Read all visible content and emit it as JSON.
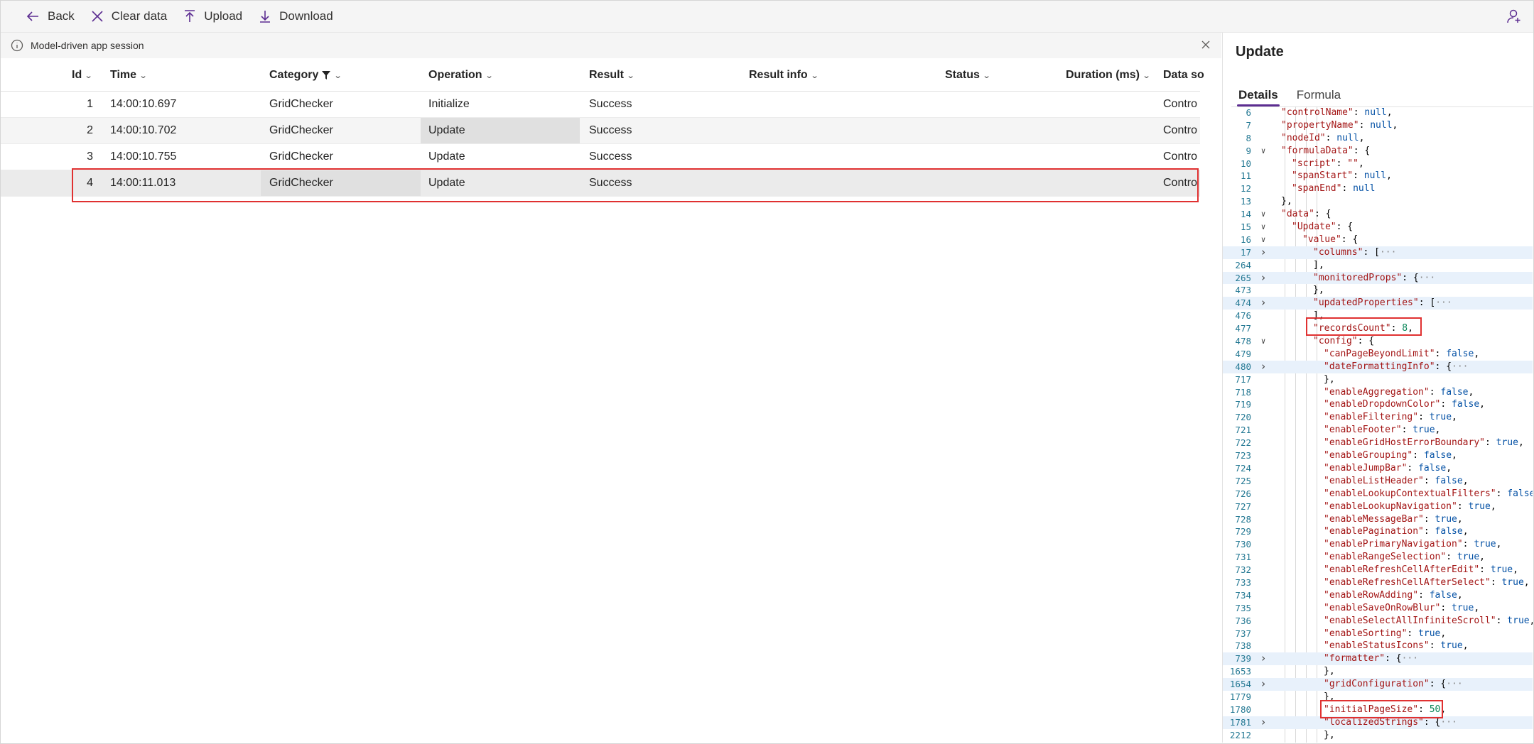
{
  "toolbar": {
    "back": "Back",
    "clear": "Clear data",
    "upload": "Upload",
    "download": "Download"
  },
  "session": {
    "label": "Model-driven app session"
  },
  "table": {
    "headers": {
      "id": "Id",
      "time": "Time",
      "category": "Category",
      "operation": "Operation",
      "result": "Result",
      "result_info": "Result info",
      "status": "Status",
      "duration": "Duration (ms)",
      "data_source": "Data so"
    },
    "rows": [
      {
        "id": "1",
        "time": "14:00:10.697",
        "category": "GridChecker",
        "operation": "Initialize",
        "result": "Success",
        "source": "Contro"
      },
      {
        "id": "2",
        "time": "14:00:10.702",
        "category": "GridChecker",
        "operation": "Update",
        "result": "Success",
        "source": "Contro"
      },
      {
        "id": "3",
        "time": "14:00:10.755",
        "category": "GridChecker",
        "operation": "Update",
        "result": "Success",
        "source": "Contro"
      },
      {
        "id": "4",
        "time": "14:00:11.013",
        "category": "GridChecker",
        "operation": "Update",
        "result": "Success",
        "source": "Contro"
      }
    ]
  },
  "panel": {
    "title": "Update",
    "tabs": [
      "Details",
      "Formula"
    ]
  },
  "editor": {
    "lines": [
      {
        "n": "6",
        "d": 0,
        "k": "\"controlName\"",
        "rest": ": null,",
        "f": ""
      },
      {
        "n": "7",
        "d": 0,
        "k": "\"propertyName\"",
        "rest": ": null,",
        "f": ""
      },
      {
        "n": "8",
        "d": 0,
        "k": "\"nodeId\"",
        "rest": ": null,",
        "f": ""
      },
      {
        "n": "9",
        "d": 0,
        "k": "\"formulaData\"",
        "rest": ": {",
        "f": "v"
      },
      {
        "n": "10",
        "d": 1,
        "k": "\"script\"",
        "rest": ": \"\",",
        "f": ""
      },
      {
        "n": "11",
        "d": 1,
        "k": "\"spanStart\"",
        "rest": ": null,",
        "f": ""
      },
      {
        "n": "12",
        "d": 1,
        "k": "\"spanEnd\"",
        "rest": ": null",
        "f": ""
      },
      {
        "n": "13",
        "d": 0,
        "k": "",
        "rest": "},",
        "f": ""
      },
      {
        "n": "14",
        "d": 0,
        "k": "\"data\"",
        "rest": ": {",
        "f": "v"
      },
      {
        "n": "15",
        "d": 1,
        "k": "\"Update\"",
        "rest": ": {",
        "f": "v"
      },
      {
        "n": "16",
        "d": 2,
        "k": "\"value\"",
        "rest": ": {",
        "f": "v"
      },
      {
        "n": "17",
        "d": 3,
        "k": "\"columns\"",
        "rest": ": [···",
        "f": ">",
        "hl": true
      },
      {
        "n": "264",
        "d": 3,
        "k": "",
        "rest": "],",
        "f": ""
      },
      {
        "n": "265",
        "d": 3,
        "k": "\"monitoredProps\"",
        "rest": ": {···",
        "f": ">",
        "hl": true
      },
      {
        "n": "473",
        "d": 3,
        "k": "",
        "rest": "},",
        "f": ""
      },
      {
        "n": "474",
        "d": 3,
        "k": "\"updatedProperties\"",
        "rest": ": [···",
        "f": ">",
        "hl": true
      },
      {
        "n": "476",
        "d": 3,
        "k": "",
        "rest": "],",
        "f": ""
      },
      {
        "n": "477",
        "d": 3,
        "k": "\"recordsCount\"",
        "rest": ": 8,",
        "f": ""
      },
      {
        "n": "478",
        "d": 3,
        "k": "\"config\"",
        "rest": ": {",
        "f": "v"
      },
      {
        "n": "479",
        "d": 4,
        "k": "\"canPageBeyondLimit\"",
        "rest": ": false,",
        "f": ""
      },
      {
        "n": "480",
        "d": 4,
        "k": "\"dateFormattingInfo\"",
        "rest": ": {···",
        "f": ">",
        "hl": true
      },
      {
        "n": "717",
        "d": 4,
        "k": "",
        "rest": "},",
        "f": ""
      },
      {
        "n": "718",
        "d": 4,
        "k": "\"enableAggregation\"",
        "rest": ": false,",
        "f": ""
      },
      {
        "n": "719",
        "d": 4,
        "k": "\"enableDropdownColor\"",
        "rest": ": false,",
        "f": ""
      },
      {
        "n": "720",
        "d": 4,
        "k": "\"enableFiltering\"",
        "rest": ": true,",
        "f": ""
      },
      {
        "n": "721",
        "d": 4,
        "k": "\"enableFooter\"",
        "rest": ": true,",
        "f": ""
      },
      {
        "n": "722",
        "d": 4,
        "k": "\"enableGridHostErrorBoundary\"",
        "rest": ": true,",
        "f": ""
      },
      {
        "n": "723",
        "d": 4,
        "k": "\"enableGrouping\"",
        "rest": ": false,",
        "f": ""
      },
      {
        "n": "724",
        "d": 4,
        "k": "\"enableJumpBar\"",
        "rest": ": false,",
        "f": ""
      },
      {
        "n": "725",
        "d": 4,
        "k": "\"enableListHeader\"",
        "rest": ": false,",
        "f": ""
      },
      {
        "n": "726",
        "d": 4,
        "k": "\"enableLookupContextualFilters\"",
        "rest": ": false,",
        "f": ""
      },
      {
        "n": "727",
        "d": 4,
        "k": "\"enableLookupNavigation\"",
        "rest": ": true,",
        "f": ""
      },
      {
        "n": "728",
        "d": 4,
        "k": "\"enableMessageBar\"",
        "rest": ": true,",
        "f": ""
      },
      {
        "n": "729",
        "d": 4,
        "k": "\"enablePagination\"",
        "rest": ": false,",
        "f": ""
      },
      {
        "n": "730",
        "d": 4,
        "k": "\"enablePrimaryNavigation\"",
        "rest": ": true,",
        "f": ""
      },
      {
        "n": "731",
        "d": 4,
        "k": "\"enableRangeSelection\"",
        "rest": ": true,",
        "f": ""
      },
      {
        "n": "732",
        "d": 4,
        "k": "\"enableRefreshCellAfterEdit\"",
        "rest": ": true,",
        "f": ""
      },
      {
        "n": "733",
        "d": 4,
        "k": "\"enableRefreshCellAfterSelect\"",
        "rest": ": true,",
        "f": ""
      },
      {
        "n": "734",
        "d": 4,
        "k": "\"enableRowAdding\"",
        "rest": ": false,",
        "f": ""
      },
      {
        "n": "735",
        "d": 4,
        "k": "\"enableSaveOnRowBlur\"",
        "rest": ": true,",
        "f": ""
      },
      {
        "n": "736",
        "d": 4,
        "k": "\"enableSelectAllInfiniteScroll\"",
        "rest": ": true,",
        "f": ""
      },
      {
        "n": "737",
        "d": 4,
        "k": "\"enableSorting\"",
        "rest": ": true,",
        "f": ""
      },
      {
        "n": "738",
        "d": 4,
        "k": "\"enableStatusIcons\"",
        "rest": ": true,",
        "f": ""
      },
      {
        "n": "739",
        "d": 4,
        "k": "\"formatter\"",
        "rest": ": {···",
        "f": ">",
        "hl": true
      },
      {
        "n": "1653",
        "d": 4,
        "k": "",
        "rest": "},",
        "f": ""
      },
      {
        "n": "1654",
        "d": 4,
        "k": "\"gridConfiguration\"",
        "rest": ": {···",
        "f": ">",
        "hl": true
      },
      {
        "n": "1779",
        "d": 4,
        "k": "",
        "rest": "},",
        "f": ""
      },
      {
        "n": "1780",
        "d": 4,
        "k": "\"initialPageSize\"",
        "rest": ": 50,",
        "f": ""
      },
      {
        "n": "1781",
        "d": 4,
        "k": "\"localizedStrings\"",
        "rest": ": {···",
        "f": ">",
        "hl": true
      },
      {
        "n": "2212",
        "d": 4,
        "k": "",
        "rest": "},",
        "f": ""
      }
    ]
  },
  "colors": {
    "accent": "#5c2d91",
    "highlight": "#e03131"
  }
}
